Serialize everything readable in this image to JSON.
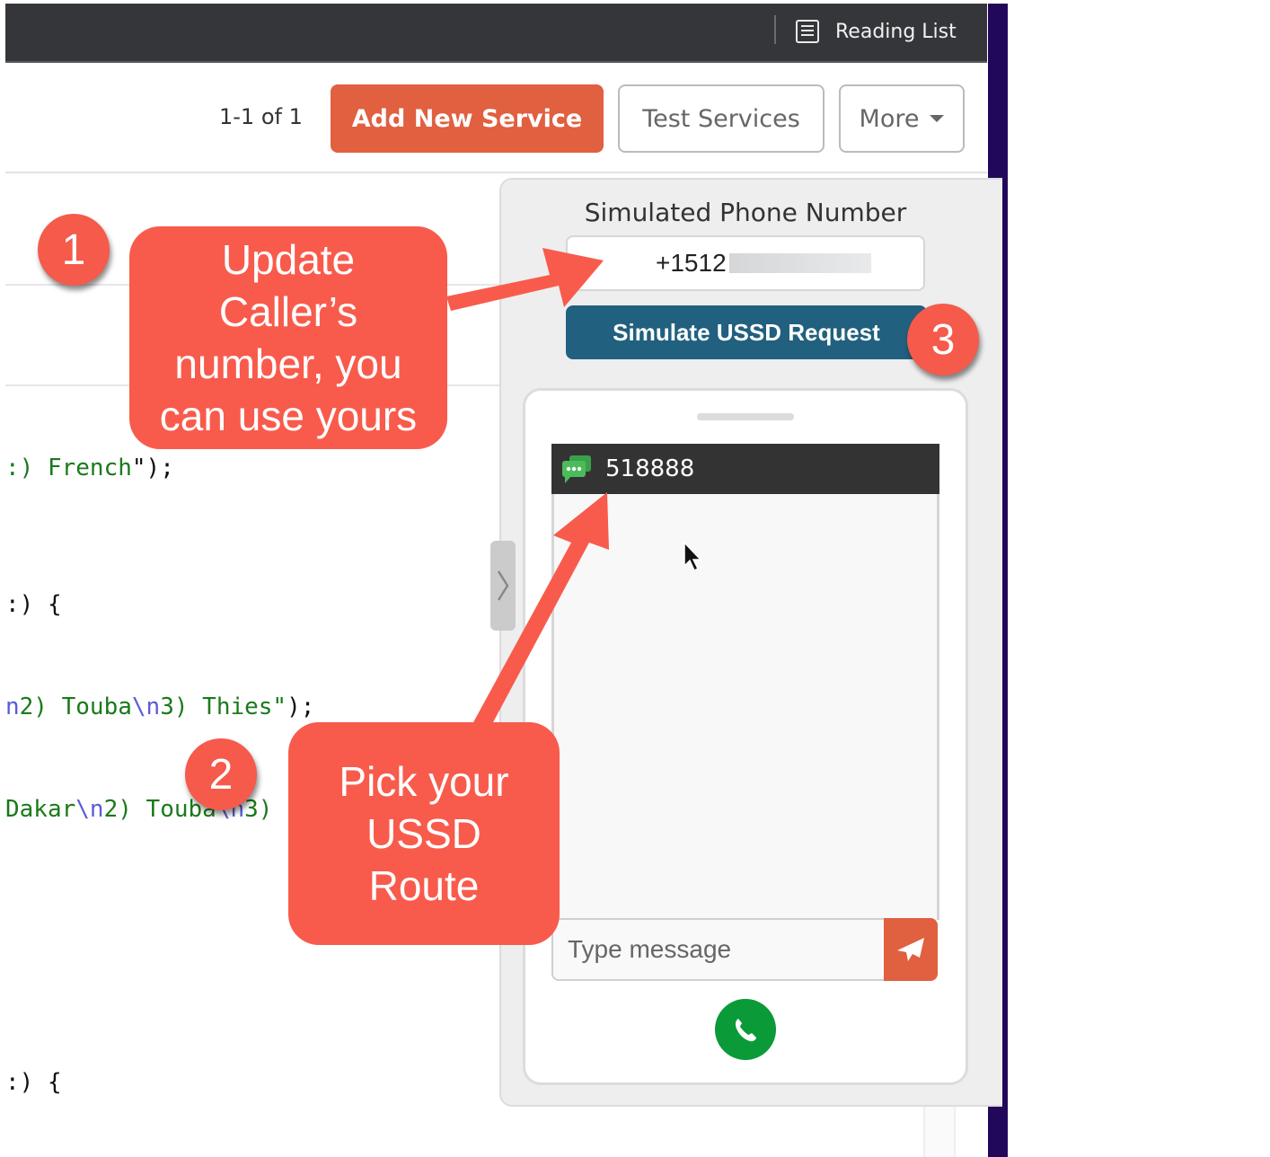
{
  "browser": {
    "reading_list_label": "Reading List",
    "reading_list_icon": "list-icon"
  },
  "toolbar": {
    "pagination": "1-1 of 1",
    "add_new_service": "Add New Service",
    "test_services": "Test Services",
    "more": "More"
  },
  "code": {
    "lines": [
      {
        "prefix": "",
        "parts": [
          {
            "t": ":) French",
            "c": "s"
          },
          {
            "t": "\");",
            "c": ""
          }
        ]
      },
      {
        "prefix": "",
        "parts": [
          {
            "t": ":) {",
            "c": ""
          }
        ]
      },
      {
        "prefix": "",
        "parts": [
          {
            "t": "n",
            "c": "e"
          },
          {
            "t": "2) Touba",
            "c": "s"
          },
          {
            "t": "\\n",
            "c": "e"
          },
          {
            "t": "3) Thies\"",
            "c": "s"
          },
          {
            "t": ");",
            "c": ""
          }
        ]
      },
      {
        "prefix": "",
        "parts": [
          {
            "t": "Dakar",
            "c": "s"
          },
          {
            "t": "\\n",
            "c": "e"
          },
          {
            "t": "2) Touba",
            "c": "s"
          },
          {
            "t": "\\n",
            "c": "e"
          },
          {
            "t": "3)",
            "c": "s"
          }
        ]
      },
      {
        "prefix": "",
        "parts": [
          {
            "t": ":) {",
            "c": ""
          }
        ]
      }
    ]
  },
  "simulator": {
    "title": "Simulated Phone Number",
    "phone_number_visible": "+1512",
    "simulate_button": "Simulate USSD Request",
    "route_number": "518888",
    "message_placeholder": "Type message",
    "icons": {
      "chat": "chat-bubbles-icon",
      "send": "paper-plane-icon",
      "call": "phone-icon",
      "collapse": "chevron-right-icon"
    },
    "colors": {
      "simulate_button": "#21607e",
      "send_button": "#e06040",
      "call_button": "#0a9a38",
      "chat_header": "#333333"
    }
  },
  "annotations": {
    "badges": [
      "1",
      "2",
      "3"
    ],
    "callout_1": [
      "Update",
      "Caller’s",
      "number, you",
      "can use yours"
    ],
    "callout_2": [
      "Pick your",
      "USSD",
      "Route"
    ],
    "color": "#f85b4c"
  },
  "colors": {
    "accent": "#e06040",
    "topbar": "#35363a",
    "side_strip": "#22085b"
  }
}
